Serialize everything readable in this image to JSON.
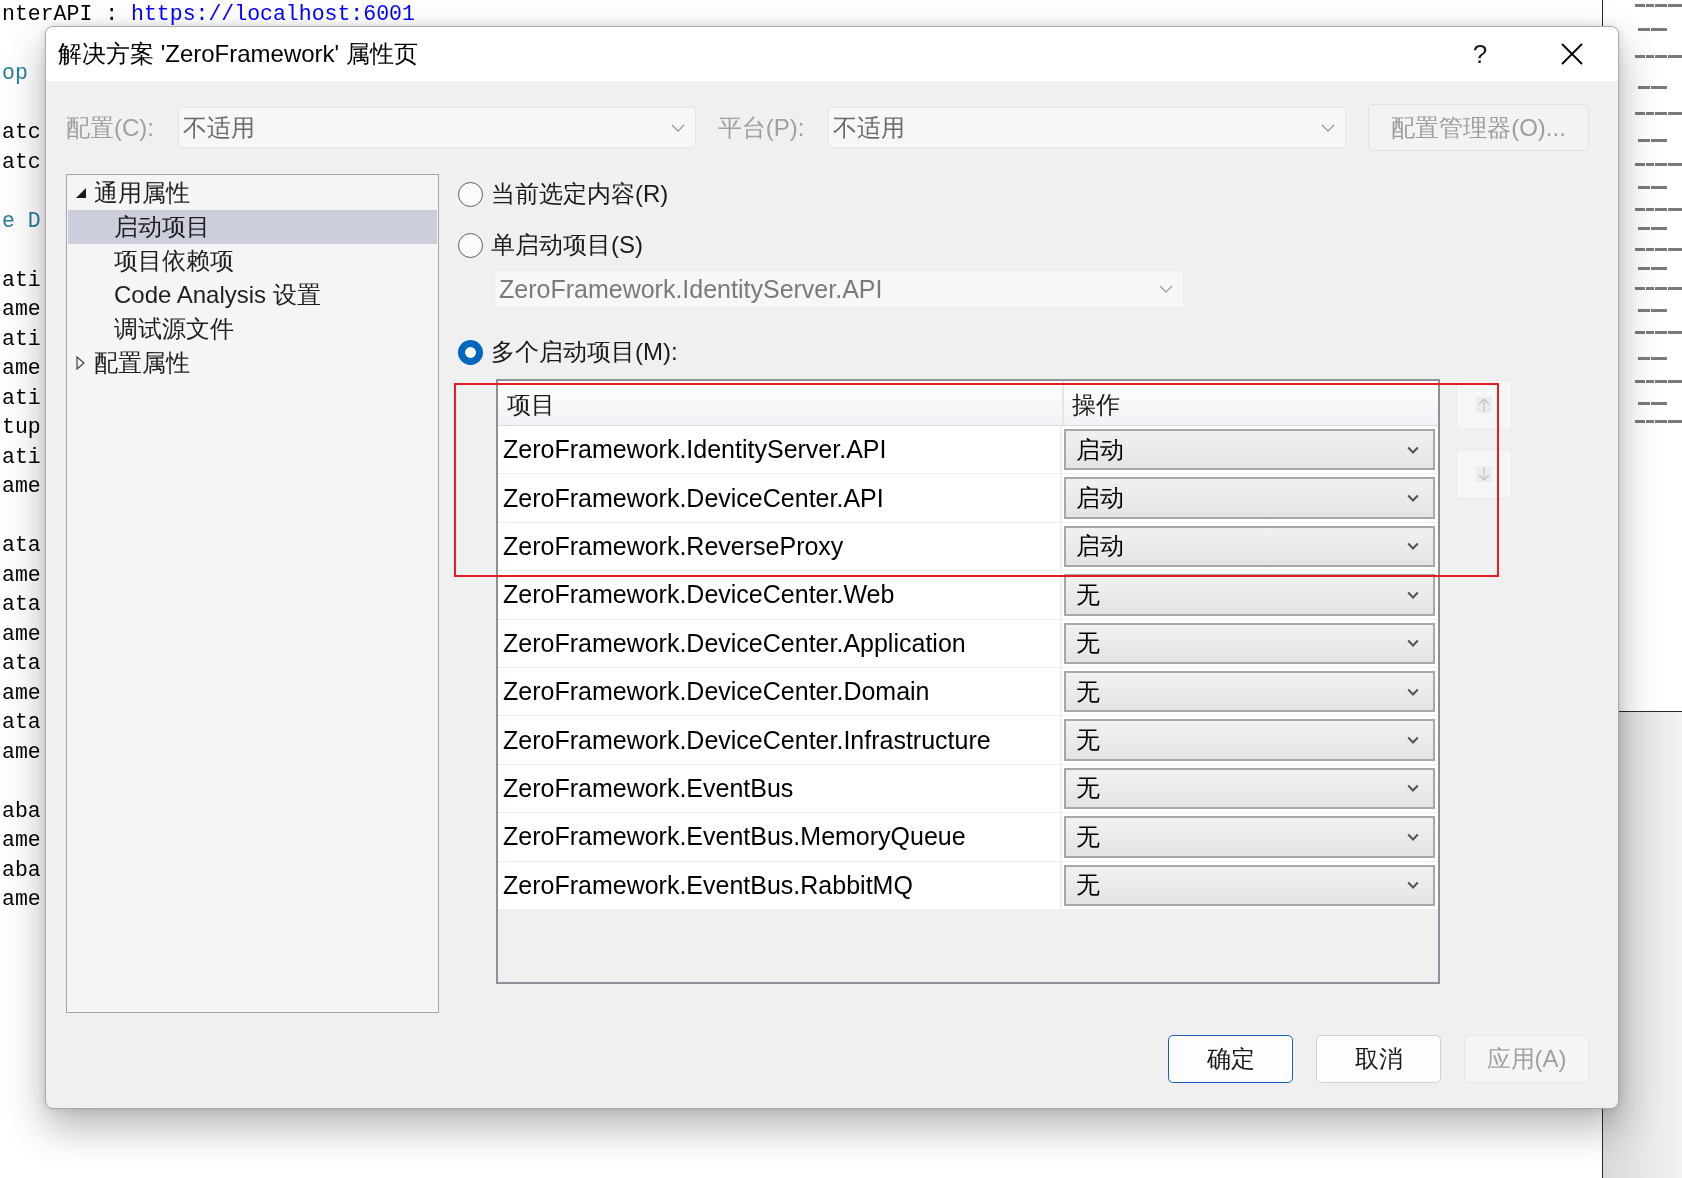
{
  "editor": {
    "blocks": [
      {
        "lines": [
          {
            "segments": [
              {
                "text": "nterAPI : ",
                "kind": "plain"
              },
              {
                "text": "https://localhost:6001",
                "kind": "url"
              }
            ]
          }
        ]
      },
      {
        "lines": [
          {
            "segments": [
              {
                "text": "op",
                "kind": "type"
              }
            ]
          }
        ]
      },
      {
        "lines": [
          {
            "segments": [
              {
                "text": "atc",
                "kind": "plain"
              }
            ]
          },
          {
            "segments": [
              {
                "text": "atc",
                "kind": "plain"
              }
            ]
          }
        ]
      },
      {
        "lines": [
          {
            "segments": [
              {
                "text": "e D",
                "kind": "type"
              }
            ]
          }
        ]
      },
      {
        "lines": [
          {
            "segments": [
              {
                "text": "ati",
                "kind": "plain"
              }
            ]
          },
          {
            "segments": [
              {
                "text": "ame",
                "kind": "plain"
              }
            ]
          },
          {
            "segments": [
              {
                "text": "ati",
                "kind": "plain"
              }
            ]
          },
          {
            "segments": [
              {
                "text": "ame",
                "kind": "plain"
              }
            ]
          },
          {
            "segments": [
              {
                "text": "ati",
                "kind": "plain"
              }
            ]
          },
          {
            "segments": [
              {
                "text": "tup",
                "kind": "plain"
              }
            ]
          },
          {
            "segments": [
              {
                "text": "ati",
                "kind": "plain"
              }
            ]
          },
          {
            "segments": [
              {
                "text": "ame",
                "kind": "plain"
              }
            ]
          }
        ]
      },
      {
        "lines": [
          {
            "segments": [
              {
                "text": "ata",
                "kind": "plain"
              }
            ]
          },
          {
            "segments": [
              {
                "text": "ame",
                "kind": "plain"
              }
            ]
          },
          {
            "segments": [
              {
                "text": "ata",
                "kind": "plain"
              }
            ]
          },
          {
            "segments": [
              {
                "text": "ame",
                "kind": "plain"
              }
            ]
          },
          {
            "segments": [
              {
                "text": "ata",
                "kind": "plain"
              }
            ]
          },
          {
            "segments": [
              {
                "text": "ame",
                "kind": "plain"
              }
            ]
          },
          {
            "segments": [
              {
                "text": "ata",
                "kind": "plain"
              }
            ]
          },
          {
            "segments": [
              {
                "text": "ame",
                "kind": "plain"
              }
            ]
          }
        ]
      },
      {
        "lines": [
          {
            "segments": [
              {
                "text": "aba",
                "kind": "plain"
              }
            ]
          },
          {
            "segments": [
              {
                "text": "ame",
                "kind": "plain"
              }
            ]
          },
          {
            "segments": [
              {
                "text": "aba",
                "kind": "plain"
              }
            ]
          },
          {
            "segments": [
              {
                "text": "ame",
                "kind": "plain"
              }
            ]
          }
        ]
      }
    ]
  },
  "dialog": {
    "title": "解决方案 'ZeroFramework' 属性页",
    "help": "?",
    "selectors": [
      {
        "label": "配置(C):",
        "value": "不适用",
        "disabled": true
      },
      {
        "label": "平台(P):",
        "value": "不适用",
        "disabled": true
      }
    ],
    "manager_button": {
      "label": "配置管理器(O)...",
      "disabled": true
    },
    "tree": [
      {
        "label": "通用属性",
        "selected": false,
        "expanded": true,
        "children": [
          {
            "label": "启动项目",
            "selected": true
          },
          {
            "label": "项目依赖项",
            "selected": false
          },
          {
            "label": "Code Analysis 设置",
            "selected": false
          },
          {
            "label": "调试源文件",
            "selected": false
          }
        ]
      },
      {
        "label": "配置属性",
        "selected": false,
        "expanded": false
      }
    ],
    "startup_options": [
      {
        "label": "当前选定内容(R)",
        "selected": false
      },
      {
        "label": "单启动项目(S)",
        "selected": false,
        "project": {
          "value": "ZeroFramework.IdentityServer.API",
          "disabled": true
        }
      },
      {
        "label": "多个启动项目(M):",
        "selected": true
      }
    ],
    "projects_table": {
      "columns": [
        "项目",
        "操作"
      ],
      "rows": [
        {
          "project": "ZeroFramework.IdentityServer.API",
          "action": "启动"
        },
        {
          "project": "ZeroFramework.DeviceCenter.API",
          "action": "启动"
        },
        {
          "project": "ZeroFramework.ReverseProxy",
          "action": "启动"
        },
        {
          "project": "ZeroFramework.DeviceCenter.Web",
          "action": "无"
        },
        {
          "project": "ZeroFramework.DeviceCenter.Application",
          "action": "无"
        },
        {
          "project": "ZeroFramework.DeviceCenter.Domain",
          "action": "无"
        },
        {
          "project": "ZeroFramework.DeviceCenter.Infrastructure",
          "action": "无"
        },
        {
          "project": "ZeroFramework.EventBus",
          "action": "无"
        },
        {
          "project": "ZeroFramework.EventBus.MemoryQueue",
          "action": "无"
        },
        {
          "project": "ZeroFramework.EventBus.RabbitMQ",
          "action": "无"
        }
      ]
    },
    "move_buttons": [
      {
        "kind": "up",
        "disabled": true
      },
      {
        "kind": "down",
        "disabled": true
      }
    ],
    "buttons": [
      {
        "label": "确定",
        "default": true,
        "disabled": false
      },
      {
        "label": "取消",
        "default": false,
        "disabled": false
      },
      {
        "label": "应用(A)",
        "default": false,
        "disabled": true
      }
    ]
  }
}
